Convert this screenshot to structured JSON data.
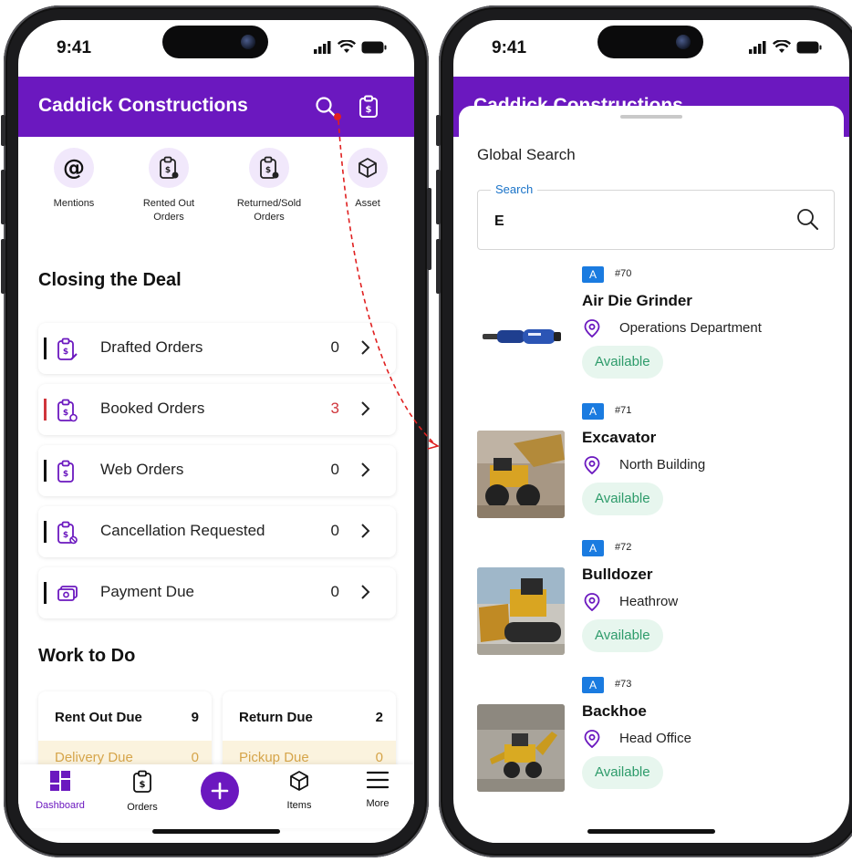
{
  "left": {
    "status": {
      "time": "9:41"
    },
    "app_title": "Caddick Constructions",
    "quick_actions": [
      {
        "label": "Mentions",
        "icon": "at-sign-icon"
      },
      {
        "label": "Rented Out\nOrders",
        "icon": "clipboard-dollar-icon"
      },
      {
        "label": "Returned/Sold\nOrders",
        "icon": "clipboard-dollar-icon"
      },
      {
        "label": "Asset",
        "icon": "cube-icon"
      }
    ],
    "section_closing": "Closing the Deal",
    "orders": [
      {
        "label": "Drafted Orders",
        "count": "0"
      },
      {
        "label": "Booked Orders",
        "count": "3"
      },
      {
        "label": "Web Orders",
        "count": "0"
      },
      {
        "label": "Cancellation Requested",
        "count": "0"
      },
      {
        "label": "Payment Due",
        "count": "0"
      }
    ],
    "section_work": "Work to Do",
    "cards": [
      {
        "title": "Rent Out Due",
        "value": "9",
        "sub_label": "Delivery Due",
        "sub_value": "0"
      },
      {
        "title": "Return Due",
        "value": "2",
        "sub_label": "Pickup Due",
        "sub_value": "0"
      }
    ],
    "nav": {
      "dashboard": "Dashboard",
      "orders": "Orders",
      "items": "Items",
      "more": "More"
    },
    "accent": "#6b18bf",
    "alert_color": "#d0363c"
  },
  "right": {
    "status": {
      "time": "9:41"
    },
    "app_title": "Caddick Constructions",
    "sheet_title": "Global Search",
    "search": {
      "label": "Search",
      "value": "E"
    },
    "results": [
      {
        "badge": "A",
        "id": "#70",
        "name": "Air Die Grinder",
        "location": "Operations Department",
        "status": "Available"
      },
      {
        "badge": "A",
        "id": "#71",
        "name": "Excavator",
        "location": "North Building",
        "status": "Available"
      },
      {
        "badge": "A",
        "id": "#72",
        "name": "Bulldozer",
        "location": "Heathrow",
        "status": "Available"
      },
      {
        "badge": "A",
        "id": "#73",
        "name": "Backhoe",
        "location": "Head Office",
        "status": "Available"
      }
    ],
    "badge_color": "#1a7be0",
    "available_color": "#2d9b6a"
  }
}
